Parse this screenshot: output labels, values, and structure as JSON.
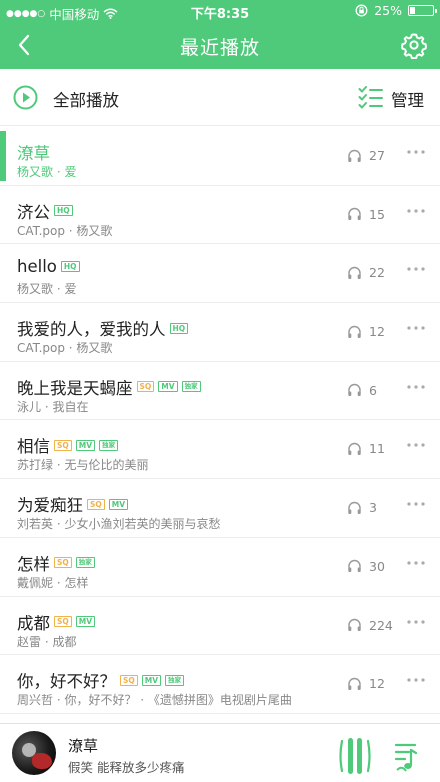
{
  "status_bar": {
    "signal": "●●●●○",
    "carrier": "中国移动",
    "time": "下午8:35",
    "battery": "25%",
    "battery_level": 0.25
  },
  "header": {
    "title": "最近播放",
    "back_icon": "chevron-left-icon",
    "settings_icon": "gear-icon"
  },
  "actions": {
    "play_all": "全部播放",
    "manage": "管理"
  },
  "songs": [
    {
      "title": "潦草",
      "subtitle": "杨又歌 · 爱",
      "tags": [],
      "plays": "27",
      "active": true
    },
    {
      "title": "济公",
      "subtitle": "CAT.pop · 杨又歌",
      "tags": [
        "HQ"
      ],
      "plays": "15"
    },
    {
      "title": "hello",
      "subtitle": "杨又歌 · 爱",
      "tags": [
        "HQ"
      ],
      "plays": "22"
    },
    {
      "title": "我爱的人，爱我的人",
      "subtitle": "CAT.pop · 杨又歌",
      "tags": [
        "HQ"
      ],
      "plays": "12"
    },
    {
      "title": "晚上我是天蝎座",
      "subtitle": "泳儿 · 我自在",
      "tags": [
        "SQ",
        "MV",
        "独家"
      ],
      "plays": "6"
    },
    {
      "title": "相信",
      "subtitle": "苏打绿 · 无与伦比的美丽",
      "tags": [
        "SQ",
        "MV",
        "独家"
      ],
      "plays": "11"
    },
    {
      "title": "为爱痴狂",
      "subtitle": "刘若英 · 少女小渔刘若英的美丽与哀愁",
      "tags": [
        "SQ",
        "MV"
      ],
      "plays": "3"
    },
    {
      "title": "怎样",
      "subtitle": "戴佩妮 · 怎样",
      "tags": [
        "SQ",
        "独家"
      ],
      "plays": "30"
    },
    {
      "title": "成都",
      "subtitle": "赵雷 · 成都",
      "tags": [
        "SQ",
        "MV"
      ],
      "plays": "224"
    },
    {
      "title": "你，好不好？",
      "subtitle": "周兴哲 · 你，好不好？ · 《遗憾拼图》电视剧片尾曲",
      "tags": [
        "SQ",
        "MV",
        "独家"
      ],
      "plays": "12"
    }
  ],
  "player": {
    "title": "潦草",
    "subtitle": "假笑 能释放多少疼痛"
  },
  "colors": {
    "accent": "#4fc97a",
    "sq_tag": "#f0b24a",
    "secondary_text": "#888888"
  }
}
